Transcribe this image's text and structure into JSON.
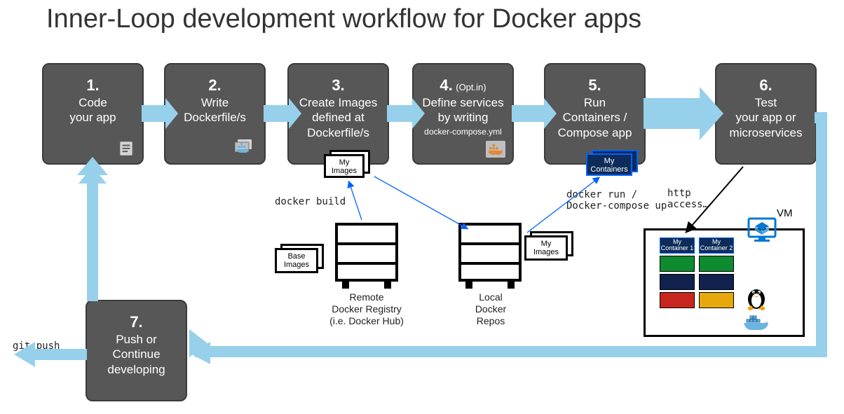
{
  "title": "Inner-Loop development workflow for Docker apps",
  "steps": {
    "s1": {
      "num": "1.",
      "txt": "Code\nyour app"
    },
    "s2": {
      "num": "2.",
      "txt": "Write\nDockerfile/s"
    },
    "s3": {
      "num": "3.",
      "txt": "Create Images\ndefined at\nDockerfile/s"
    },
    "s4": {
      "num": "4.",
      "opt": "(Opt.in)",
      "txt": "Define services\nby writing",
      "sub": "docker-compose.yml"
    },
    "s5": {
      "num": "5.",
      "txt": "Run\nContainers /\nCompose app"
    },
    "s6": {
      "num": "6.",
      "txt": "Test\nyour app or\nmicroservices"
    },
    "s7": {
      "num": "7.",
      "txt": "Push or\nContinue\ndeveloping"
    }
  },
  "labels": {
    "docker_build": "docker build",
    "docker_run": "docker run /\nDocker-compose up",
    "git_push": "git push",
    "http_access": "http\naccess…",
    "vm": "VM"
  },
  "cards": {
    "my_images": "My\nImages",
    "base_images": "Base\nImages",
    "my_containers": "My\nContainers",
    "my_container1": "My\nContainer 1",
    "my_container2": "My\nContainer 2"
  },
  "captions": {
    "remote_registry": "Remote\nDocker Registry\n(i.e. Docker Hub)",
    "local_repos": "Local\nDocker\nRepos"
  }
}
